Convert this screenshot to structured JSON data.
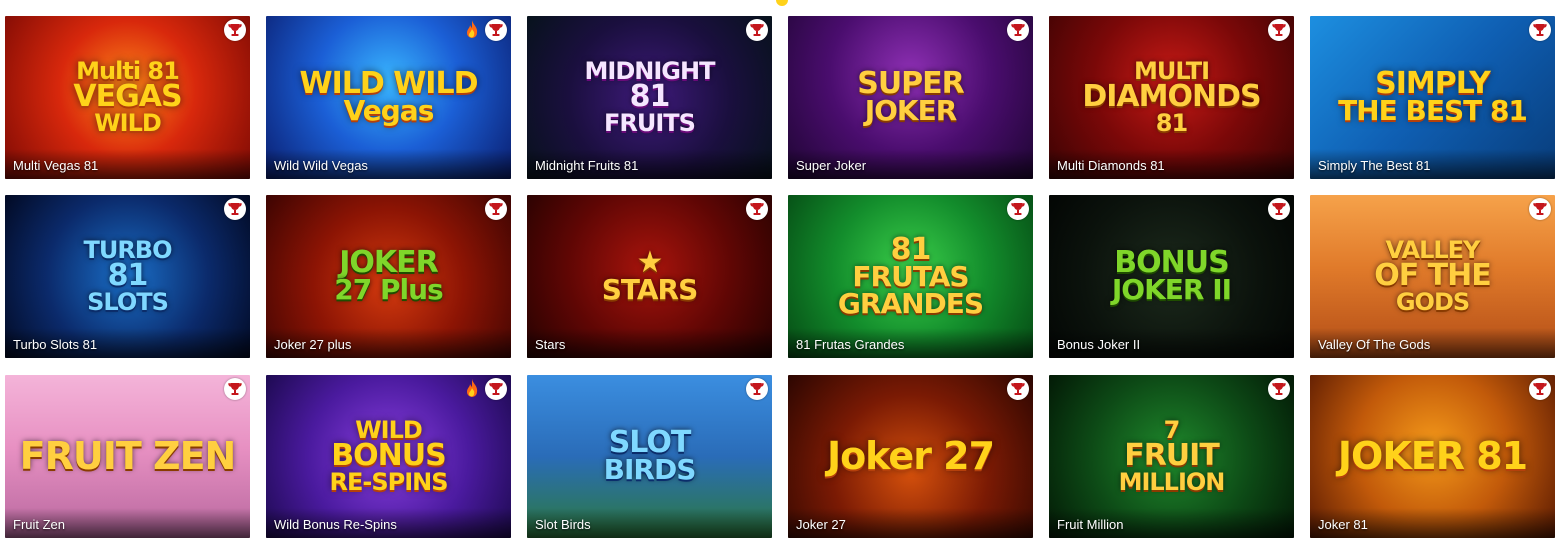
{
  "games": [
    {
      "name": "Multi Vegas 81",
      "art_lines": [
        "Multi 81",
        "VEGAS",
        "WILD"
      ],
      "bg": "radial-gradient(circle at 50% 45%, #ff8a1a 0%, #d8280c 45%, #7d0a04 100%)",
      "style": "yellow",
      "hot": false,
      "icon": "trophy-icon"
    },
    {
      "name": "Wild Wild Vegas",
      "art_lines": [
        "WILD WILD",
        "Vegas"
      ],
      "bg": "radial-gradient(circle at 50% 40%, #39b6ff 0%, #1b5fd6 45%, #0a1d6e 100%)",
      "style": "yellow",
      "hot": true,
      "icon": "trophy-icon"
    },
    {
      "name": "Midnight Fruits 81",
      "art_lines": [
        "MIDNIGHT",
        "81",
        "FRUITS"
      ],
      "bg": "radial-gradient(circle at 50% 50%, #3e1a7a 0%, #1a0f3e 55%, #07121c 100%)",
      "style": "pinkpurple",
      "hot": false,
      "icon": "trophy-icon"
    },
    {
      "name": "Super Joker",
      "art_lines": [
        "SUPER",
        "JOKER"
      ],
      "bg": "radial-gradient(circle at 50% 35%, #8d2fb3 0%, #4a0d6e 50%, #1e0532 100%)",
      "style": "gold",
      "hot": false,
      "icon": "trophy-icon"
    },
    {
      "name": "Multi Diamonds 81",
      "art_lines": [
        "MULTI",
        "DIAMONDS",
        "81"
      ],
      "bg": "radial-gradient(circle at 50% 40%, #c81a16 0%, #7a0808 50%, #3a0303 100%)",
      "style": "gold",
      "hot": false,
      "icon": "trophy-icon"
    },
    {
      "name": "Simply The Best 81",
      "art_lines": [
        "SIMPLY",
        "THE BEST 81"
      ],
      "bg": "linear-gradient(135deg, #1d8fe0 0%, #0f5fb3 50%, #083c7a 100%)",
      "style": "yellow",
      "hot": false,
      "icon": "trophy-icon"
    },
    {
      "name": "Turbo Slots 81",
      "art_lines": [
        "TURBO",
        "81",
        "SLOTS"
      ],
      "bg": "radial-gradient(circle at 50% 50%, #1a6fc8 0%, #0b2a6b 55%, #020a24 100%)",
      "style": "blue-t",
      "hot": false,
      "icon": "trophy-icon"
    },
    {
      "name": "Joker 27 plus",
      "art_lines": [
        "JOKER",
        "27 Plus"
      ],
      "bg": "radial-gradient(circle at 50% 55%, #d43a0e 0%, #8c1404 50%, #3d0402 100%)",
      "style": "green",
      "hot": false,
      "icon": "trophy-icon"
    },
    {
      "name": "Stars",
      "art_lines": [
        "★",
        "STARS"
      ],
      "bg": "radial-gradient(circle at 50% 45%, #a8140c 0%, #5e0604 55%, #250201 100%)",
      "style": "gold",
      "hot": false,
      "icon": "trophy-icon"
    },
    {
      "name": "81 Frutas Grandes",
      "art_lines": [
        "81",
        "FRUTAS GRANDES"
      ],
      "bg": "radial-gradient(circle at 50% 45%, #3bcf4a 0%, #138d2c 50%, #054a14 100%)",
      "style": "gold",
      "hot": false,
      "icon": "trophy-icon"
    },
    {
      "name": "Bonus Joker II",
      "art_lines": [
        "BONUS",
        "JOKER II"
      ],
      "bg": "radial-gradient(circle at 50% 50%, #1c2a1c 0%, #0b120c 60%, #030604 100%)",
      "style": "green",
      "hot": false,
      "icon": "trophy-icon"
    },
    {
      "name": "Valley Of The Gods",
      "art_lines": [
        "VALLEY",
        "OF THE",
        "GODS"
      ],
      "bg": "linear-gradient(180deg, #f6a24a 0%, #e07a2a 45%, #b24c16 100%)",
      "style": "gold",
      "hot": false,
      "icon": "trophy-icon"
    },
    {
      "name": "Fruit Zen",
      "art_lines": [
        "FRUIT ZEN"
      ],
      "bg": "linear-gradient(180deg, #f4b4d9 0%, #e790c2 45%, #b7679e 100%)",
      "style": "gold",
      "hot": false,
      "icon": "trophy-icon"
    },
    {
      "name": "Wild Bonus Re-Spins",
      "art_lines": [
        "WILD",
        "BONUS",
        "RE-SPINS"
      ],
      "bg": "radial-gradient(circle at 50% 50%, #8a3fe0 0%, #4a1a9e 55%, #1e0a52 100%)",
      "style": "yellow",
      "hot": true,
      "icon": "trophy-icon"
    },
    {
      "name": "Slot Birds",
      "art_lines": [
        "SLOT",
        "BIRDS"
      ],
      "bg": "linear-gradient(180deg, #3b8ee0 0%, #2a6cb8 50%, #2c7a3c 100%)",
      "style": "blue-t",
      "hot": false,
      "icon": "trophy-icon"
    },
    {
      "name": "Joker 27",
      "art_lines": [
        "Joker 27"
      ],
      "bg": "radial-gradient(circle at 50% 60%, #d4500c 0%, #7a1a04 50%, #2c0601 100%)",
      "style": "yellow",
      "hot": false,
      "icon": "trophy-icon"
    },
    {
      "name": "Fruit Million",
      "art_lines": [
        "7",
        "FRUIT",
        "MILLION"
      ],
      "bg": "radial-gradient(circle at 50% 50%, #1f8a2c 0%, #0d4a16 55%, #031a06 100%)",
      "style": "gold",
      "hot": false,
      "icon": "trophy-icon"
    },
    {
      "name": "Joker 81",
      "art_lines": [
        "JOKER 81"
      ],
      "bg": "radial-gradient(circle at 50% 45%, #f59a1a 0%, #c25a0a 50%, #5a1a02 100%)",
      "style": "yellow",
      "hot": false,
      "icon": "trophy-icon"
    }
  ],
  "colors": {
    "badge_red": "#c4161c",
    "fire_orange": "#ff6a13",
    "caption_text": "#ffffff",
    "page_bg": "#ffffff"
  }
}
